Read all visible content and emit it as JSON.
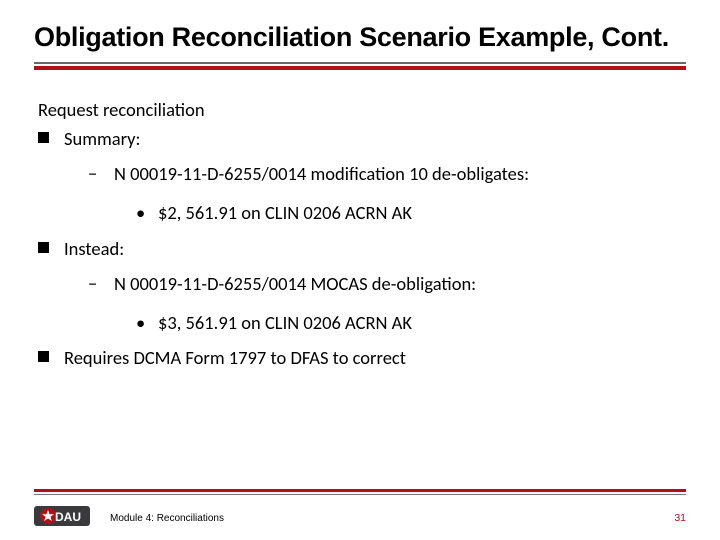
{
  "title": "Obligation Reconciliation Scenario Example, Cont.",
  "body": {
    "request": "Request reconciliation",
    "summary_label": "Summary:",
    "summary_sub": "N 00019-11-D-6255/0014 modification 10 de-obligates:",
    "summary_detail": "$2, 561.91 on CLIN 0206 ACRN AK",
    "instead_label": "Instead:",
    "instead_sub": "N 00019-11-D-6255/0014 MOCAS de-obligation:",
    "instead_detail": "$3, 561.91 on CLIN 0206 ACRN AK",
    "requires": "Requires DCMA Form 1797 to DFAS to correct"
  },
  "footer": {
    "module": "Module 4: Reconciliations",
    "page": "31",
    "logo_text": "DAU"
  }
}
